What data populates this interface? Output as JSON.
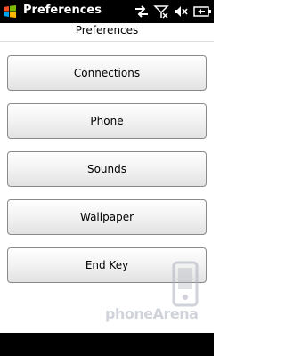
{
  "titlebar": {
    "title": "Preferences",
    "icons": [
      "windows-start-icon",
      "network-arrows-icon",
      "signal-off-icon",
      "speaker-mute-icon",
      "battery-icon"
    ]
  },
  "page": {
    "header": "Preferences"
  },
  "buttons": [
    {
      "label": "Connections"
    },
    {
      "label": "Phone"
    },
    {
      "label": "Sounds"
    },
    {
      "label": "Wallpaper"
    },
    {
      "label": "End Key"
    }
  ],
  "watermark": {
    "text": "phoneArena"
  },
  "colors": {
    "bar": "#000000",
    "background": "#ffffff",
    "button_border": "#8a8a8a"
  }
}
